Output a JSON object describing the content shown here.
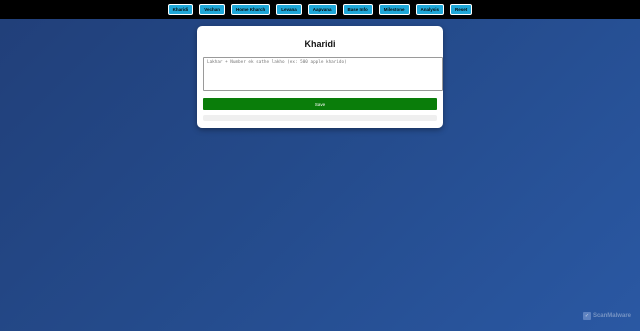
{
  "nav": {
    "items": [
      "Kharidi",
      "Vechan",
      "Home Kharch",
      "Levana",
      "Aapvana",
      "Base Info",
      "Milestone",
      "Analysis",
      "Reset"
    ]
  },
  "card": {
    "title": "Kharidi",
    "textarea_placeholder": "Lakhar + Number ek sathe lakho (ex: 500 apple kharido)",
    "textarea_value": "",
    "save_label": "Save"
  },
  "watermark": {
    "text": "ScanMalware",
    "icon": "scanmalware-logo-icon"
  },
  "colors": {
    "nav_button_bg": "#1ea7d8",
    "save_button_bg": "#0a7d0a",
    "topbar_bg": "#000000",
    "page_bg": "#244a8a"
  }
}
